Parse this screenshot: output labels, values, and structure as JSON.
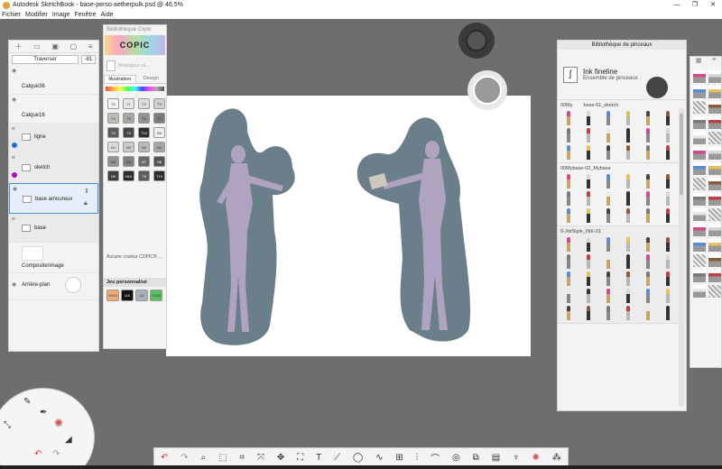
{
  "window": {
    "title": "Autodesk SketchBook - base-perso-aetherpulk.psd @ 46,5%",
    "controls": [
      "—",
      "❐",
      "✕"
    ]
  },
  "menu": [
    "Fichier",
    "Modifier",
    "Image",
    "Fenêtre",
    "Aide"
  ],
  "layers": {
    "blend_mode": "Traverser",
    "opacity": "-81",
    "items": [
      {
        "name": "Calque36"
      },
      {
        "name": "Calque16"
      },
      {
        "name": "ligne",
        "color": "#1e6fd9"
      },
      {
        "name": "sketch",
        "color": "#b000c8"
      },
      {
        "name": "base amoureux"
      },
      {
        "name": "base"
      },
      {
        "name": "Composite/image"
      },
      {
        "name": "Arrière-plan"
      }
    ]
  },
  "copic": {
    "header": "Bibliothèque Copic",
    "logo": "COPIC",
    "search_placeholder": "Mélangeur ca...",
    "tabs": [
      "Illustration",
      "Design"
    ],
    "swatches": [
      {
        "label": "T0",
        "color": "#f2f2ee"
      },
      {
        "label": "T1",
        "color": "#e8e8e4"
      },
      {
        "label": "T2",
        "color": "#dedede"
      },
      {
        "label": "T3",
        "color": "#d0d0cc"
      },
      {
        "label": "T4",
        "color": "#bdbdb8"
      },
      {
        "label": "T5",
        "color": "#a9a9a4"
      },
      {
        "label": "T6",
        "color": "#929290"
      },
      {
        "label": "T7",
        "color": "#7b7b78"
      },
      {
        "label": "T8",
        "color": "#5c5c5a"
      },
      {
        "label": "T9",
        "color": "#464644"
      },
      {
        "label": "T10",
        "color": "#2e2e2c"
      },
      {
        "label": "N0",
        "color": "#eeeeec"
      },
      {
        "label": "N1",
        "color": "#dcdcda"
      },
      {
        "label": "N2",
        "color": "#cbcbc8"
      },
      {
        "label": "N3",
        "color": "#b8b8b5"
      },
      {
        "label": "N4",
        "color": "#a5a5a2"
      },
      {
        "label": "N5",
        "color": "#939391"
      },
      {
        "label": "N6",
        "color": "#80807e"
      },
      {
        "label": "N7",
        "color": "#6b6b69"
      },
      {
        "label": "N8",
        "color": "#555553"
      },
      {
        "label": "N9",
        "color": "#3e3e3c"
      },
      {
        "label": "N10",
        "color": "#2a2a28"
      },
      {
        "label": "T8",
        "color": "#5c5c5a"
      },
      {
        "label": "T10",
        "color": "#2e2e2c"
      }
    ],
    "no_info": "Aucune couleur COPIC® ...",
    "jeu_label": "Jeu personnalisé",
    "jeu_swatches": [
      {
        "label": "E000",
        "color": "#f1a874"
      },
      {
        "label": "110",
        "color": "#111111"
      },
      {
        "label": "C3",
        "color": "#a8b0b8"
      },
      {
        "label": "YG23",
        "color": "#57c25d"
      }
    ]
  },
  "brushlib": {
    "header": "Bibliothèque de pinceaux",
    "current_name": "Ink fineline",
    "current_set": "Ensemble de pinceaux :",
    "groups": [
      {
        "title": "00My",
        "subtitle": "base-01_sketch"
      },
      {
        "title": "00Mybase-02_Mybase",
        "subtitle": ""
      },
      {
        "title": "0-JdrStyle_INK-01",
        "subtitle": ""
      }
    ]
  }
}
